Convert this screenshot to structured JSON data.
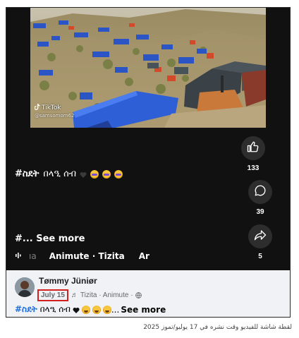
{
  "video": {
    "watermark_brand": "TikTok",
    "watermark_handle": "@samsomom62"
  },
  "rail": {
    "like_count": "133",
    "comment_count": "39",
    "share_count": "5"
  },
  "overlay_caption": {
    "hashtag": "#ስደት",
    "text": "በላዒ ሰብ"
  },
  "overlay_see_more": "#... See more",
  "audio": {
    "faded_left": "ıa",
    "label": "Animute · Tizita",
    "faded_right": "Ar"
  },
  "post": {
    "poster_name": "Tømmy Jüniør",
    "date": "July 15",
    "music_note": "♬",
    "audio_info": "Tizita · Animute ·",
    "caption_hashtag": "#ስደት",
    "caption_text": "በላዒ ሰብ",
    "caption_ellipsis": "...",
    "see_more": "See more"
  },
  "figure_caption": "لقطة شاشة للفيديو وقت نشره في 17 يوليو/تموز 2025",
  "colors": {
    "dark_bg": "#111111",
    "fb_bg": "#f0f2f5",
    "hashtag_blue": "#216fdb",
    "date_highlight": "#d21f1f"
  }
}
